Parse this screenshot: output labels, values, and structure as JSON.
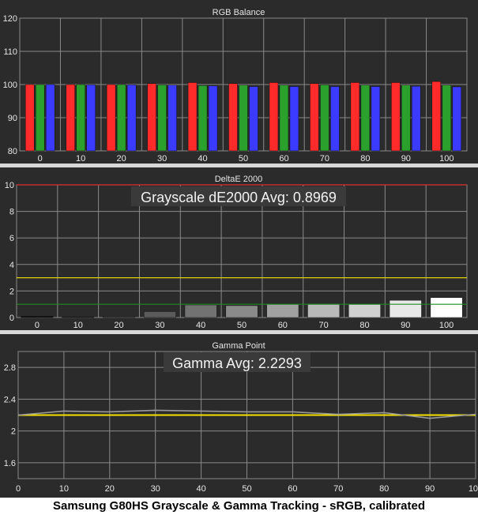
{
  "caption": "Samsung G80HS Grayscale & Gamma Tracking - sRGB, calibrated",
  "colors": {
    "background": "#2b2b2b",
    "grid": "#8a8a8a",
    "text": "#e6e6e6",
    "red": "#ff2a2a",
    "green": "#2ca02c",
    "blue": "#3b3bff",
    "threshold_red": "#e03030",
    "threshold_yellow": "#e0d000",
    "threshold_green": "#1e8c1e",
    "gamma_target": "#f2e200",
    "gamma_measured": "#9a9a9a"
  },
  "chart_data": [
    {
      "type": "bar",
      "title": "RGB Balance",
      "categories": [
        "0",
        "10",
        "20",
        "30",
        "40",
        "50",
        "60",
        "70",
        "80",
        "90",
        "100"
      ],
      "ylim": [
        80,
        120
      ],
      "yticks": [
        80,
        90,
        100,
        110,
        120
      ],
      "grid": true,
      "series": [
        {
          "color": "red",
          "values": [
            100,
            100,
            100,
            100.3,
            100.6,
            100.3,
            100.6,
            100.3,
            100.6,
            100.6,
            100.9
          ]
        },
        {
          "color": "green",
          "values": [
            100,
            100,
            100,
            99.9,
            99.7,
            99.8,
            99.8,
            99.9,
            99.8,
            99.8,
            99.8
          ]
        },
        {
          "color": "blue",
          "values": [
            100,
            99.9,
            99.9,
            99.8,
            99.6,
            99.4,
            99.4,
            99.4,
            99.4,
            99.5,
            99.3
          ]
        }
      ]
    },
    {
      "type": "bar",
      "title": "DeltaE 2000",
      "annotation": "Grayscale dE2000 Avg: 0.8969",
      "categories": [
        "0",
        "10",
        "20",
        "30",
        "40",
        "50",
        "60",
        "70",
        "80",
        "90",
        "100"
      ],
      "ylim": [
        0,
        10
      ],
      "yticks": [
        0,
        2,
        4,
        6,
        8,
        10
      ],
      "grid": true,
      "values": [
        0.1,
        0.05,
        0.1,
        0.45,
        0.95,
        0.9,
        1.0,
        1.05,
        1.0,
        1.3,
        1.5
      ],
      "thresholds": [
        {
          "value": 10,
          "color": "threshold_red"
        },
        {
          "value": 3,
          "color": "threshold_yellow"
        },
        {
          "value": 1,
          "color": "threshold_green"
        }
      ]
    },
    {
      "type": "line",
      "title": "Gamma Point",
      "annotation": "Gamma Avg: 2.2293",
      "x": [
        0,
        10,
        20,
        30,
        40,
        50,
        60,
        70,
        80,
        90,
        100
      ],
      "xlim": [
        0,
        100
      ],
      "xticks": [
        0,
        10,
        20,
        30,
        40,
        50,
        60,
        70,
        80,
        90,
        100
      ],
      "ylim": [
        1.4,
        3.0
      ],
      "yticks": [
        1.6,
        2,
        2.4,
        2.8
      ],
      "grid": true,
      "series": [
        {
          "color": "gamma_target",
          "values": [
            2.2,
            2.2,
            2.2,
            2.2,
            2.2,
            2.2,
            2.2,
            2.2,
            2.2,
            2.2,
            2.2
          ]
        },
        {
          "color": "gamma_measured",
          "values": [
            2.2,
            2.25,
            2.24,
            2.26,
            2.25,
            2.24,
            2.24,
            2.21,
            2.23,
            2.16,
            2.21
          ]
        }
      ]
    }
  ]
}
